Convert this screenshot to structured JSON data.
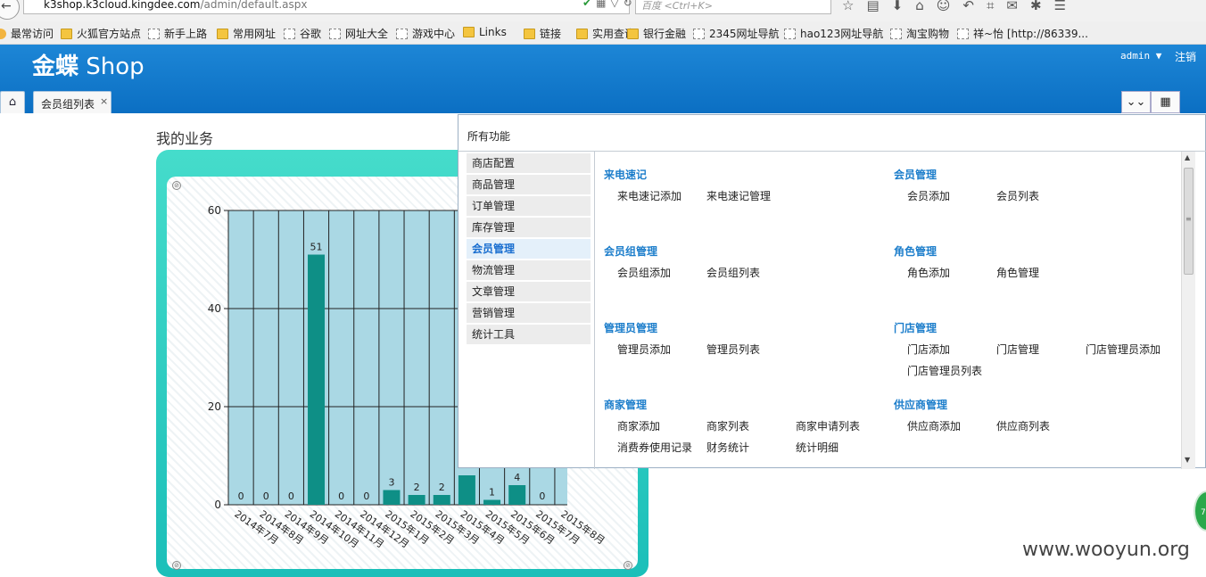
{
  "browser": {
    "url_host": "k3shop.k3cloud.kingdee.com",
    "url_path": "/admin/default.aspx",
    "search_placeholder": "百度 <Ctrl+K>",
    "bookmarks": [
      {
        "label": "最常访问",
        "icon": "gear-icon"
      },
      {
        "label": "火狐官方站点",
        "icon": "folder-icon"
      },
      {
        "label": "新手上路",
        "icon": "page-icon"
      },
      {
        "label": "常用网址",
        "icon": "folder-icon"
      },
      {
        "label": "谷歌",
        "icon": "page-icon"
      },
      {
        "label": "网址大全",
        "icon": "page-icon"
      },
      {
        "label": "游戏中心",
        "icon": "page-icon"
      },
      {
        "label": "Links",
        "icon": "folder-icon"
      },
      {
        "label": "链接",
        "icon": "folder-icon"
      },
      {
        "label": "实用查询",
        "icon": "folder-icon"
      },
      {
        "label": "银行金融",
        "icon": "folder-icon"
      },
      {
        "label": "2345网址导航",
        "icon": "page-icon"
      },
      {
        "label": "hao123网址导航",
        "icon": "page-icon"
      },
      {
        "label": "淘宝购物",
        "icon": "page-icon"
      },
      {
        "label": "祥~怡 [http://86339...",
        "icon": "page-icon"
      }
    ]
  },
  "header": {
    "logo_cn": "金蝶",
    "logo_en": "Shop",
    "user": "admin",
    "logout": "注销",
    "tabs": [
      {
        "label": "会员组列表",
        "close": "×"
      }
    ],
    "accent": "#1079cc"
  },
  "content": {
    "title": "我的业务"
  },
  "menu": {
    "title": "所有功能",
    "categories": [
      "商店配置",
      "商品管理",
      "订单管理",
      "库存管理",
      "会员管理",
      "物流管理",
      "文章管理",
      "营销管理",
      "统计工具"
    ],
    "active_category": "会员管理",
    "groups": [
      {
        "title": "来电速记",
        "items": [
          "来电速记添加",
          "来电速记管理"
        ]
      },
      {
        "title": "会员管理",
        "items": [
          "会员添加",
          "会员列表"
        ]
      },
      {
        "title": "会员组管理",
        "items": [
          "会员组添加",
          "会员组列表"
        ]
      },
      {
        "title": "角色管理",
        "items": [
          "角色添加",
          "角色管理"
        ]
      },
      {
        "title": "管理员管理",
        "items": [
          "管理员添加",
          "管理员列表"
        ]
      },
      {
        "title": "门店管理",
        "items": [
          "门店添加",
          "门店管理",
          "门店管理员添加",
          "门店管理员列表"
        ]
      },
      {
        "title": "商家管理",
        "items": [
          "商家添加",
          "商家列表",
          "商家申请列表",
          "消费券使用记录",
          "财务统计",
          "统计明细"
        ]
      },
      {
        "title": "供应商管理",
        "items": [
          "供应商添加",
          "供应商列表"
        ]
      }
    ]
  },
  "watermark": "www.wooyun.org",
  "chart_data": {
    "type": "bar",
    "categories": [
      "2014年7月",
      "2014年8月",
      "2014年9月",
      "2014年10月",
      "2014年11月",
      "2014年12月",
      "2015年1月",
      "2015年2月",
      "2015年3月",
      "2015年4月",
      "2015年5月",
      "2015年6月",
      "2015年7月",
      "2015年8月"
    ],
    "values": [
      0,
      0,
      0,
      51,
      0,
      0,
      3,
      2,
      2,
      6,
      1,
      4,
      0,
      null
    ],
    "value_labels": [
      "0",
      "0",
      "0",
      "51",
      "0",
      "0",
      "3",
      "2",
      "2",
      "",
      "1",
      "4",
      "0",
      ""
    ],
    "yticks": [
      "0",
      "20",
      "40",
      "60"
    ],
    "ylim": [
      0,
      60
    ],
    "bar_color": "#0e8f86",
    "plot_bg": "#aad8e4",
    "grid": true
  }
}
